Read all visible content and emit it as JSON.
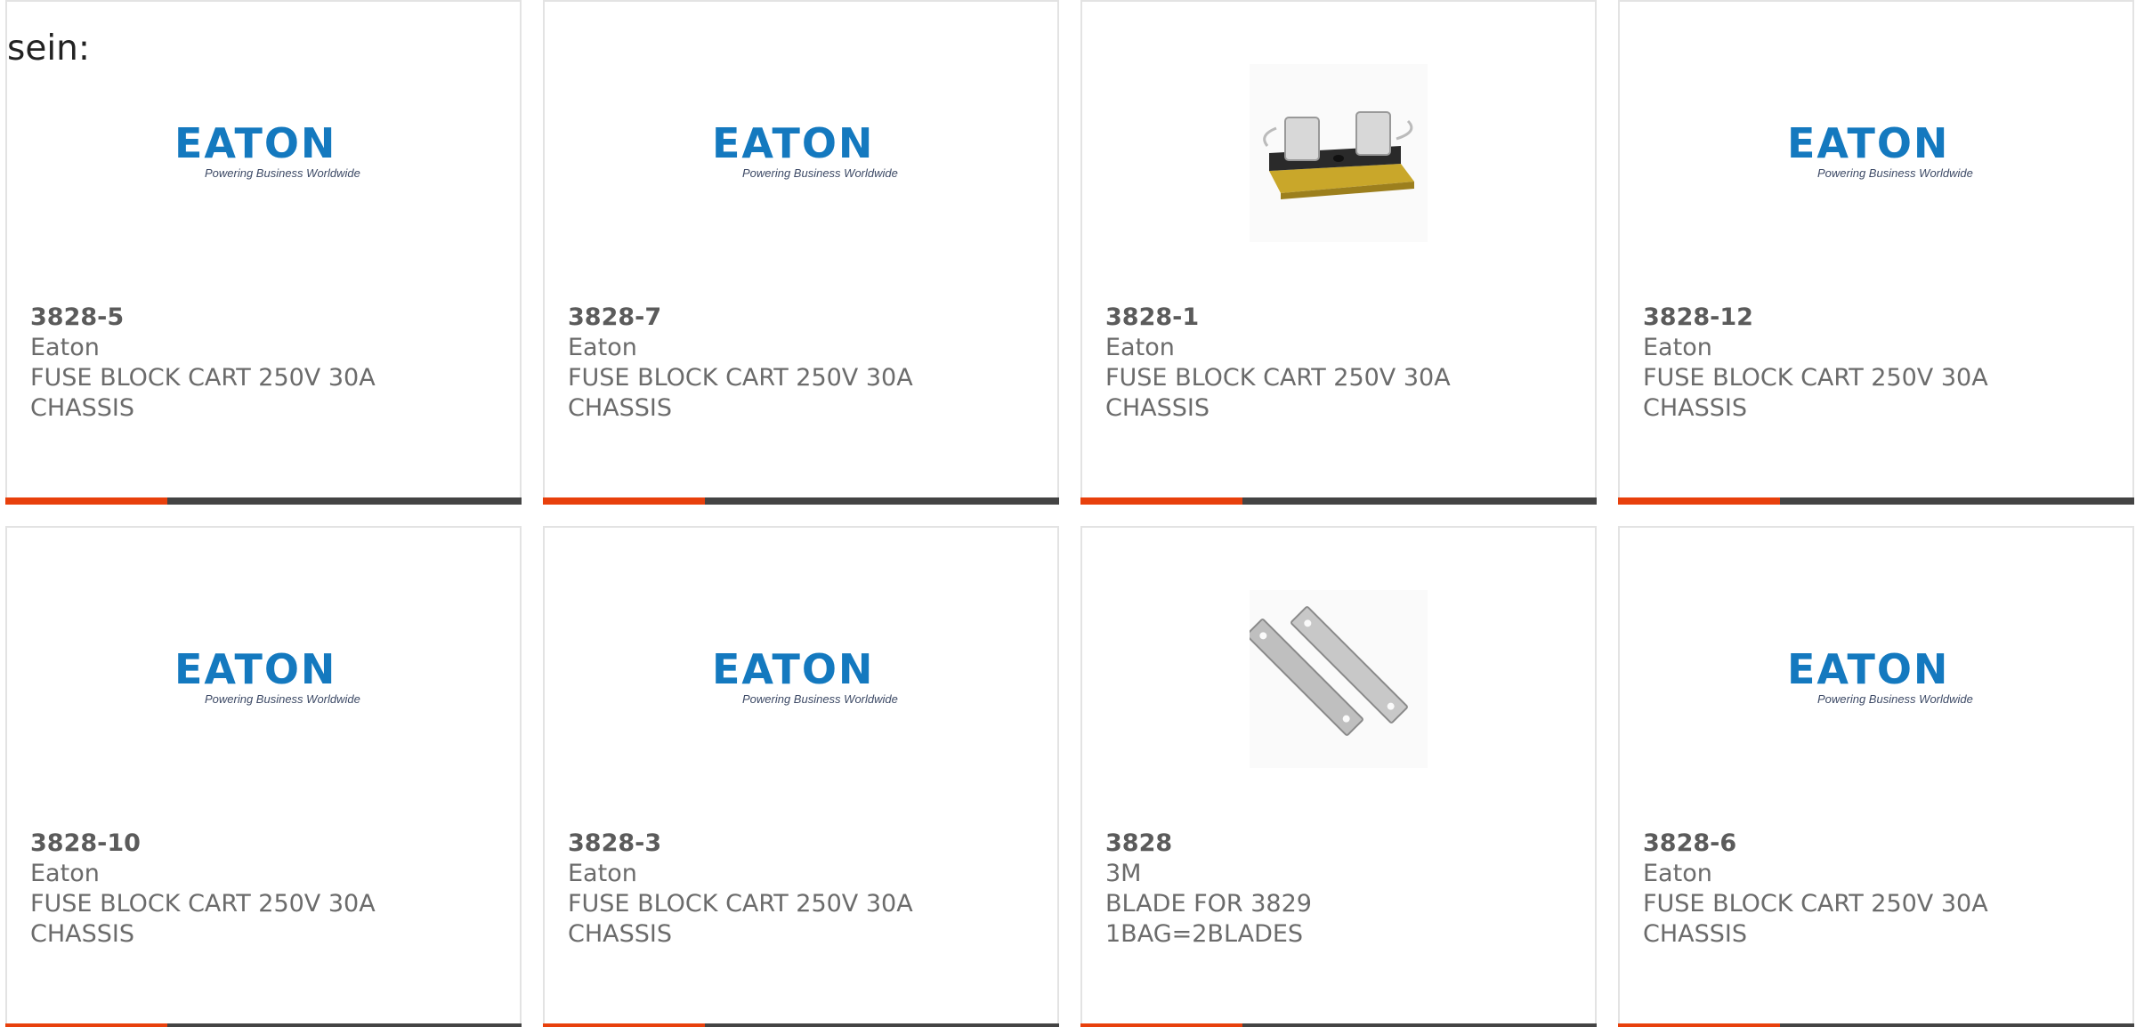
{
  "intro_text": "sein:",
  "brand": {
    "accent_color": "#e8400c",
    "bar_color": "#444444",
    "eaton_logo_text": "EATON",
    "eaton_tagline": "Powering Business Worldwide"
  },
  "products": [
    {
      "part": "3828-5",
      "manufacturer": "Eaton",
      "description": "FUSE BLOCK CART 250V 30A CHASSIS",
      "image": "eaton-logo"
    },
    {
      "part": "3828-7",
      "manufacturer": "Eaton",
      "description": "FUSE BLOCK CART 250V 30A CHASSIS",
      "image": "eaton-logo"
    },
    {
      "part": "3828-1",
      "manufacturer": "Eaton",
      "description": "FUSE BLOCK CART 250V 30A CHASSIS",
      "image": "fuse-block-photo"
    },
    {
      "part": "3828-12",
      "manufacturer": "Eaton",
      "description": "FUSE BLOCK CART 250V 30A CHASSIS",
      "image": "eaton-logo"
    },
    {
      "part": "3828-10",
      "manufacturer": "Eaton",
      "description": "FUSE BLOCK CART 250V 30A CHASSIS",
      "image": "eaton-logo"
    },
    {
      "part": "3828-3",
      "manufacturer": "Eaton",
      "description": "FUSE BLOCK CART 250V 30A CHASSIS",
      "image": "eaton-logo"
    },
    {
      "part": "3828",
      "manufacturer": "3M",
      "description": "BLADE FOR 3829 1BAG=2BLADES",
      "image": "blade-photo"
    },
    {
      "part": "3828-6",
      "manufacturer": "Eaton",
      "description": "FUSE BLOCK CART 250V 30A CHASSIS",
      "image": "eaton-logo"
    }
  ]
}
